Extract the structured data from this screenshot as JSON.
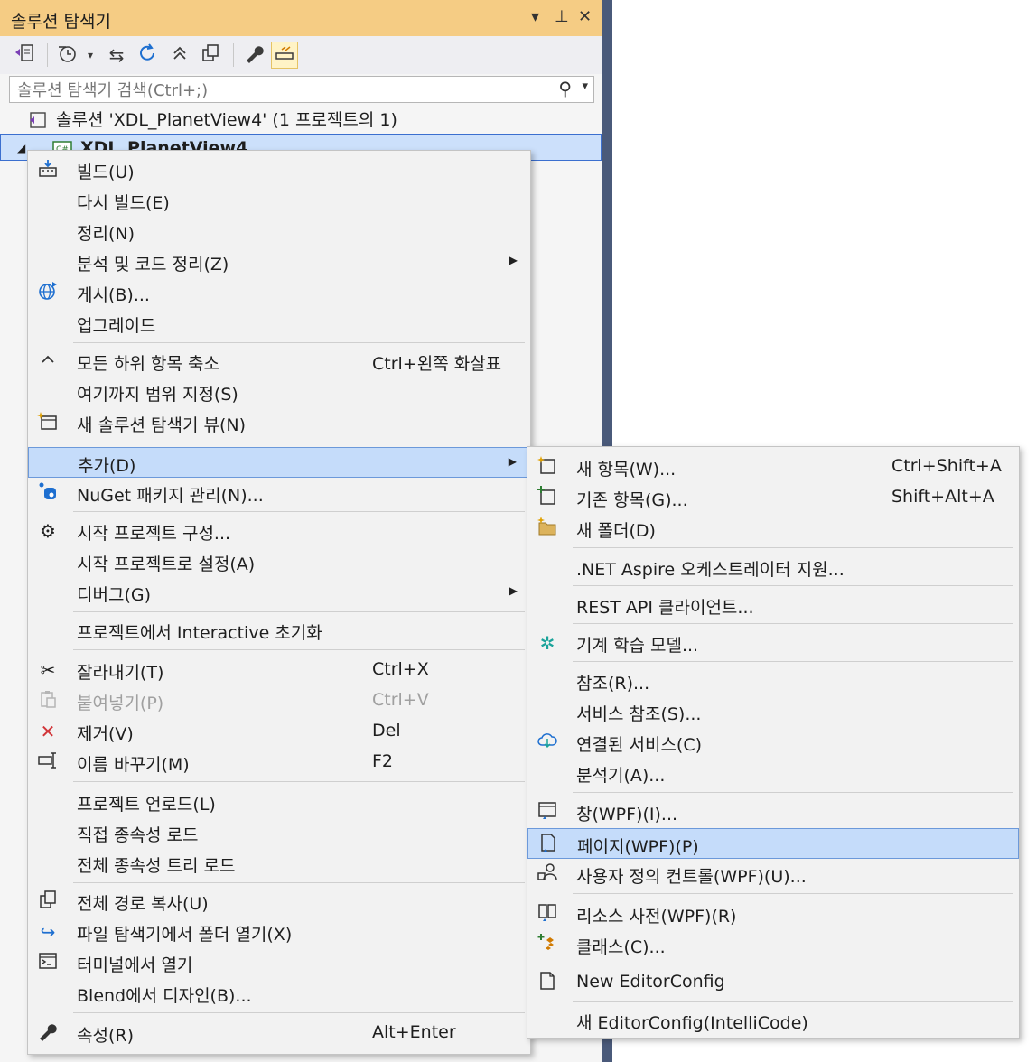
{
  "panel": {
    "title": "솔루션 탐색기",
    "title_controls": {
      "dropdown": "▾",
      "pin": "⊥",
      "close": "✕"
    },
    "search": {
      "placeholder": "솔루션 탐색기 검색(Ctrl+;)"
    },
    "tree": {
      "solution_label": "솔루션 'XDL_PlanetView4' (1 프로젝트의 1)",
      "project_label": "XDL_PlanetView4"
    }
  },
  "context_menu": {
    "items": [
      {
        "label": "빌드(U)",
        "icon": "build-icon"
      },
      {
        "label": "다시 빌드(E)"
      },
      {
        "label": "정리(N)"
      },
      {
        "label": "분석 및 코드 정리(Z)",
        "submenu": true
      },
      {
        "label": "게시(B)...",
        "icon": "globe-publish-icon"
      },
      {
        "label": "업그레이드"
      },
      {
        "label": "모든 하위 항목 축소",
        "shortcut": "Ctrl+왼쪽 화살표",
        "icon": "collapse-icon"
      },
      {
        "label": "여기까지 범위 지정(S)"
      },
      {
        "label": "새 솔루션 탐색기 뷰(N)",
        "icon": "new-view-icon"
      },
      {
        "label": "추가(D)",
        "submenu": true,
        "highlighted": true
      },
      {
        "label": "NuGet 패키지 관리(N)...",
        "icon": "nuget-icon"
      },
      {
        "label": "시작 프로젝트 구성...",
        "icon": "gear-icon"
      },
      {
        "label": "시작 프로젝트로 설정(A)"
      },
      {
        "label": "디버그(G)",
        "submenu": true
      },
      {
        "label": "프로젝트에서 Interactive 초기화"
      },
      {
        "label": "잘라내기(T)",
        "shortcut": "Ctrl+X",
        "icon": "scissors-icon"
      },
      {
        "label": "붙여넣기(P)",
        "shortcut": "Ctrl+V",
        "icon": "paste-icon",
        "disabled": true
      },
      {
        "label": "제거(V)",
        "shortcut": "Del",
        "icon": "remove-icon"
      },
      {
        "label": "이름 바꾸기(M)",
        "shortcut": "F2",
        "icon": "rename-icon"
      },
      {
        "label": "프로젝트 언로드(L)"
      },
      {
        "label": "직접 종속성 로드"
      },
      {
        "label": "전체 종속성 트리 로드"
      },
      {
        "label": "전체 경로 복사(U)",
        "icon": "copy-icon"
      },
      {
        "label": "파일 탐색기에서 폴더 열기(X)",
        "icon": "open-folder-icon"
      },
      {
        "label": "터미널에서 열기",
        "icon": "terminal-icon"
      },
      {
        "label": "Blend에서 디자인(B)..."
      },
      {
        "label": "속성(R)",
        "shortcut": "Alt+Enter",
        "icon": "wrench-icon"
      }
    ]
  },
  "add_submenu": {
    "items": [
      {
        "label": "새 항목(W)...",
        "shortcut": "Ctrl+Shift+A",
        "icon": "new-item-icon"
      },
      {
        "label": "기존 항목(G)...",
        "shortcut": "Shift+Alt+A",
        "icon": "existing-item-icon"
      },
      {
        "label": "새 폴더(D)",
        "icon": "new-folder-icon"
      },
      {
        "label": ".NET Aspire 오케스트레이터 지원..."
      },
      {
        "label": "REST API 클라이언트..."
      },
      {
        "label": "기계 학습 모델...",
        "icon": "ml-model-icon"
      },
      {
        "label": "참조(R)..."
      },
      {
        "label": "서비스 참조(S)..."
      },
      {
        "label": "연결된 서비스(C)",
        "icon": "connected-service-icon"
      },
      {
        "label": "분석기(A)..."
      },
      {
        "label": "창(WPF)(I)...",
        "icon": "window-icon"
      },
      {
        "label": "페이지(WPF)(P)",
        "icon": "page-icon",
        "highlighted": true
      },
      {
        "label": "사용자 정의 컨트롤(WPF)(U)...",
        "icon": "user-control-icon"
      },
      {
        "label": "리소스 사전(WPF)(R)",
        "icon": "resource-dictionary-icon"
      },
      {
        "label": "클래스(C)...",
        "icon": "class-icon"
      },
      {
        "label": "New EditorConfig",
        "icon": "file-icon"
      },
      {
        "label": "새 EditorConfig(IntelliCode)"
      }
    ]
  },
  "colors": {
    "title_bar": "#f5cc84",
    "highlight": "#c5dcfa",
    "highlight_border": "#6c99da",
    "panel_border": "#4a5a7a"
  }
}
